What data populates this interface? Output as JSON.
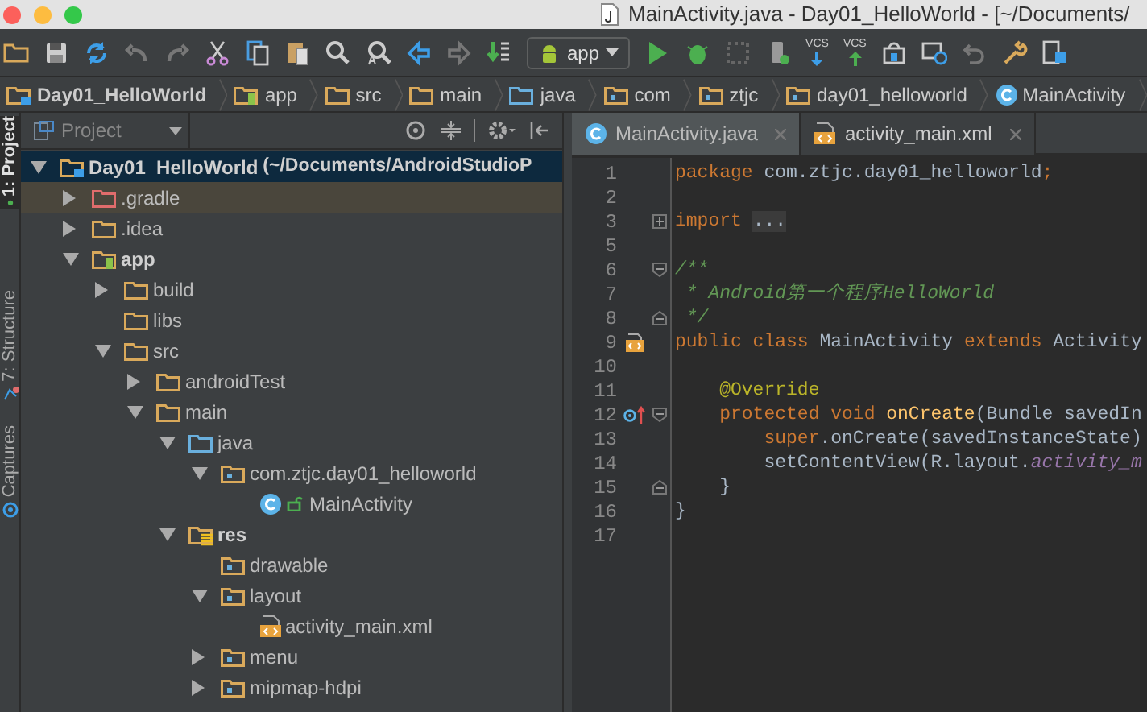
{
  "window": {
    "title": "MainActivity.java - Day01_HelloWorld - [~/Documents/"
  },
  "toolbar": {
    "run_config": "app",
    "vcs_buttons": [
      "VCS",
      "VCS"
    ]
  },
  "breadcrumbs": [
    {
      "label": "Day01_HelloWorld",
      "kind": "project"
    },
    {
      "label": "app",
      "kind": "module"
    },
    {
      "label": "src",
      "kind": "folder"
    },
    {
      "label": "main",
      "kind": "folder"
    },
    {
      "label": "java",
      "kind": "source"
    },
    {
      "label": "com",
      "kind": "package"
    },
    {
      "label": "ztjc",
      "kind": "package"
    },
    {
      "label": "day01_helloworld",
      "kind": "package"
    },
    {
      "label": "MainActivity",
      "kind": "class"
    }
  ],
  "side_tabs": [
    {
      "label": "1: Project",
      "selected": true
    },
    {
      "label": "7: Structure",
      "selected": false
    },
    {
      "label": "Captures",
      "selected": false
    }
  ],
  "project_panel": {
    "view": "Project",
    "tree": [
      {
        "name": "Day01_HelloWorld",
        "path": "(~/Documents/AndroidStudioP",
        "kind": "project",
        "expanded": true,
        "selected": true,
        "highlighted": false,
        "children": [
          {
            "name": ".gradle",
            "kind": "excluded",
            "expanded": false,
            "selected": false,
            "highlighted": true
          },
          {
            "name": ".idea",
            "kind": "folder",
            "expanded": false,
            "selected": false,
            "highlighted": false
          },
          {
            "name": "app",
            "kind": "module",
            "expanded": true,
            "selected": false,
            "highlighted": false,
            "children": [
              {
                "name": "build",
                "kind": "folder",
                "expanded": false,
                "selected": false,
                "highlighted": false
              },
              {
                "name": "libs",
                "kind": "folder",
                "selected": false,
                "highlighted": false
              },
              {
                "name": "src",
                "kind": "folder",
                "expanded": true,
                "selected": false,
                "highlighted": false,
                "children": [
                  {
                    "name": "androidTest",
                    "kind": "folder",
                    "expanded": false,
                    "selected": false,
                    "highlighted": false
                  },
                  {
                    "name": "main",
                    "kind": "folder",
                    "expanded": true,
                    "selected": false,
                    "highlighted": false,
                    "children": [
                      {
                        "name": "java",
                        "kind": "source",
                        "expanded": true,
                        "selected": false,
                        "highlighted": false,
                        "children": [
                          {
                            "name": "com.ztjc.day01_helloworld",
                            "kind": "package",
                            "expanded": true,
                            "selected": false,
                            "highlighted": false,
                            "children": [
                              {
                                "name": "MainActivity",
                                "kind": "class",
                                "selected": false,
                                "highlighted": false
                              }
                            ]
                          }
                        ]
                      },
                      {
                        "name": "res",
                        "kind": "res",
                        "expanded": true,
                        "selected": false,
                        "highlighted": false,
                        "children": [
                          {
                            "name": "drawable",
                            "kind": "package",
                            "selected": false,
                            "highlighted": false
                          },
                          {
                            "name": "layout",
                            "kind": "package",
                            "expanded": true,
                            "selected": false,
                            "highlighted": false,
                            "children": [
                              {
                                "name": "activity_main.xml",
                                "kind": "xml",
                                "selected": false,
                                "highlighted": false
                              }
                            ]
                          },
                          {
                            "name": "menu",
                            "kind": "package",
                            "expanded": false,
                            "selected": false,
                            "highlighted": false
                          },
                          {
                            "name": "mipmap-hdpi",
                            "kind": "package",
                            "expanded": false,
                            "selected": false,
                            "highlighted": false
                          }
                        ]
                      }
                    ]
                  }
                ]
              }
            ]
          }
        ]
      }
    ]
  },
  "editor": {
    "tabs": [
      {
        "label": "MainActivity.java",
        "kind": "class",
        "selected": true
      },
      {
        "label": "activity_main.xml",
        "kind": "xml",
        "selected": false
      }
    ],
    "lines": [
      {
        "number": "1",
        "kind": "plain",
        "segments": [
          {
            "kind": "keyword",
            "text": "package "
          },
          {
            "kind": "plain",
            "text": "com.ztjc.day01_helloworld"
          },
          {
            "kind": "keyword",
            "text": ";"
          }
        ]
      },
      {
        "number": "2",
        "kind": "plain"
      },
      {
        "number": "3",
        "kind": "fold-closed",
        "segments": [
          {
            "kind": "keyword",
            "text": "import "
          },
          {
            "kind": "folded",
            "text": "..."
          }
        ]
      },
      {
        "number": "5",
        "kind": "plain"
      },
      {
        "number": "6",
        "kind": "fold-start",
        "segments": [
          {
            "kind": "doc",
            "text": "/**"
          }
        ]
      },
      {
        "number": "7",
        "kind": "plain",
        "segments": [
          {
            "kind": "doc",
            "text": " * Android第一个程序HelloWorld"
          }
        ]
      },
      {
        "number": "8",
        "kind": "fold-end",
        "segments": [
          {
            "kind": "doc",
            "text": " */"
          }
        ]
      },
      {
        "number": "9",
        "kind": "layout-link",
        "segments": [
          {
            "kind": "keyword",
            "text": "public class "
          },
          {
            "kind": "plain",
            "text": "MainActivity "
          },
          {
            "kind": "keyword",
            "text": "extends "
          },
          {
            "kind": "plain",
            "text": "Activity"
          }
        ]
      },
      {
        "number": "10",
        "kind": "plain"
      },
      {
        "number": "11",
        "kind": "plain",
        "segments": [
          {
            "kind": "annotation",
            "text": "    @Override"
          }
        ]
      },
      {
        "number": "12",
        "kind": "override-fold-start",
        "segments": [
          {
            "kind": "keyword",
            "text": "    protected void "
          },
          {
            "kind": "method",
            "text": "onCreate"
          },
          {
            "kind": "plain",
            "text": "(Bundle savedIn"
          }
        ]
      },
      {
        "number": "13",
        "kind": "plain",
        "segments": [
          {
            "kind": "keyword",
            "text": "        super"
          },
          {
            "kind": "plain",
            "text": ".onCreate(savedInstanceState)"
          }
        ]
      },
      {
        "number": "14",
        "kind": "plain",
        "segments": [
          {
            "kind": "plain",
            "text": "        setContentView(R.layout."
          },
          {
            "kind": "field",
            "text": "activity_m"
          }
        ]
      },
      {
        "number": "15",
        "kind": "fold-end",
        "segments": [
          {
            "kind": "plain",
            "text": "    }"
          }
        ]
      },
      {
        "number": "16",
        "kind": "plain",
        "segments": [
          {
            "kind": "plain",
            "text": "}"
          }
        ]
      },
      {
        "number": "17",
        "kind": "plain"
      }
    ]
  }
}
